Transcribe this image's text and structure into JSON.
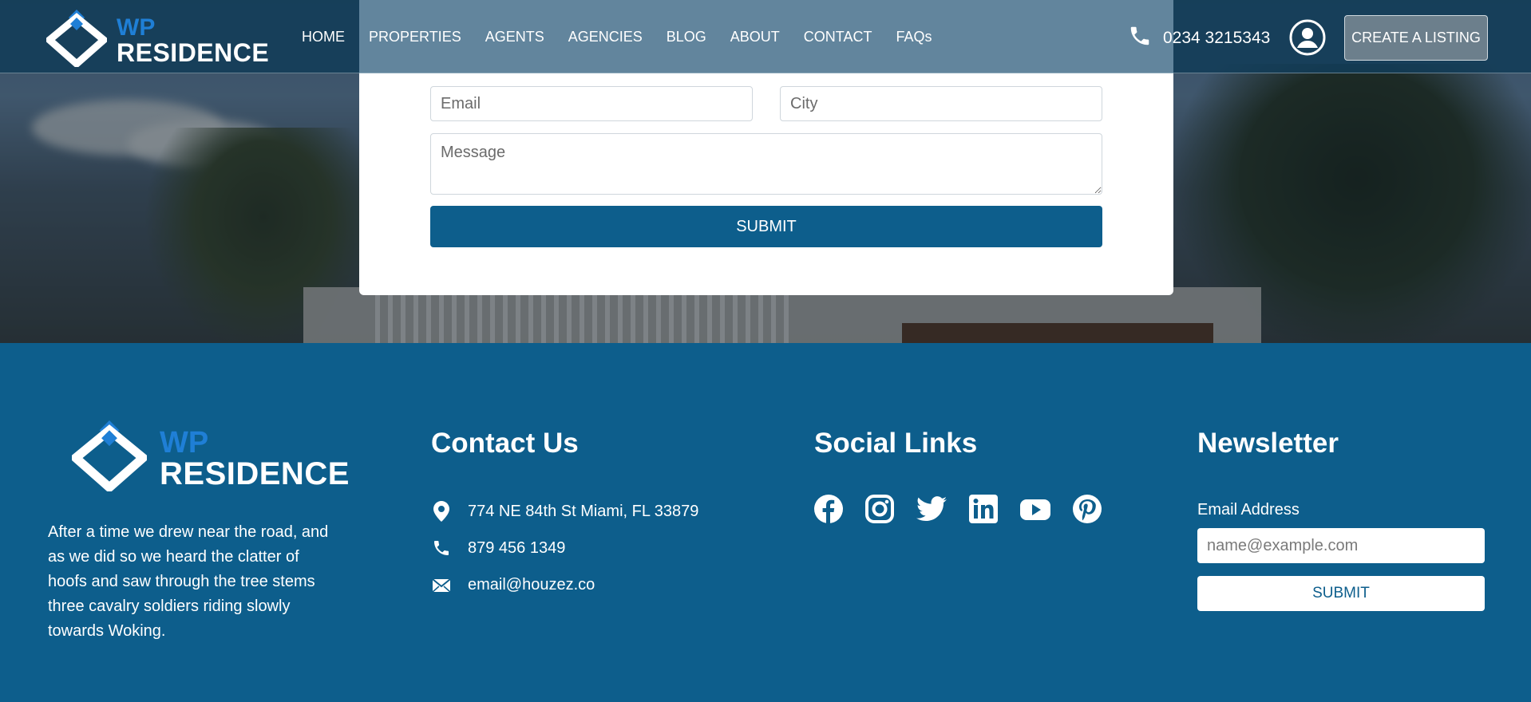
{
  "header": {
    "logo": {
      "wp": "WP",
      "name": "RESIDENCE"
    },
    "nav": [
      "HOME",
      "PROPERTIES",
      "AGENTS",
      "AGENCIES",
      "BLOG",
      "ABOUT",
      "CONTACT",
      "FAQs"
    ],
    "phone": "0234 3215343",
    "create_listing": "CREATE A LISTING"
  },
  "form": {
    "email_placeholder": "Email",
    "city_placeholder": "City",
    "message_placeholder": "Message",
    "submit": "SUBMIT"
  },
  "footer": {
    "logo": {
      "wp": "WP",
      "name": "RESIDENCE"
    },
    "about": "After a time we drew near the road, and as we did so we heard the clatter of hoofs and saw through the tree stems three cavalry soldiers riding slowly towards Woking.",
    "contact": {
      "title": "Contact Us",
      "address": "774 NE 84th St Miami, FL 33879",
      "phone": "879 456 1349",
      "email": "email@houzez.co"
    },
    "social": {
      "title": "Social Links",
      "icons": [
        "facebook-icon",
        "instagram-icon",
        "twitter-icon",
        "linkedin-icon",
        "youtube-icon",
        "pinterest-icon"
      ]
    },
    "newsletter": {
      "title": "Newsletter",
      "label": "Email Address",
      "placeholder": "name@example.com",
      "submit": "SUBMIT"
    }
  },
  "colors": {
    "brand_blue": "#0d5e8c",
    "logo_accent": "#1f7fd6"
  }
}
